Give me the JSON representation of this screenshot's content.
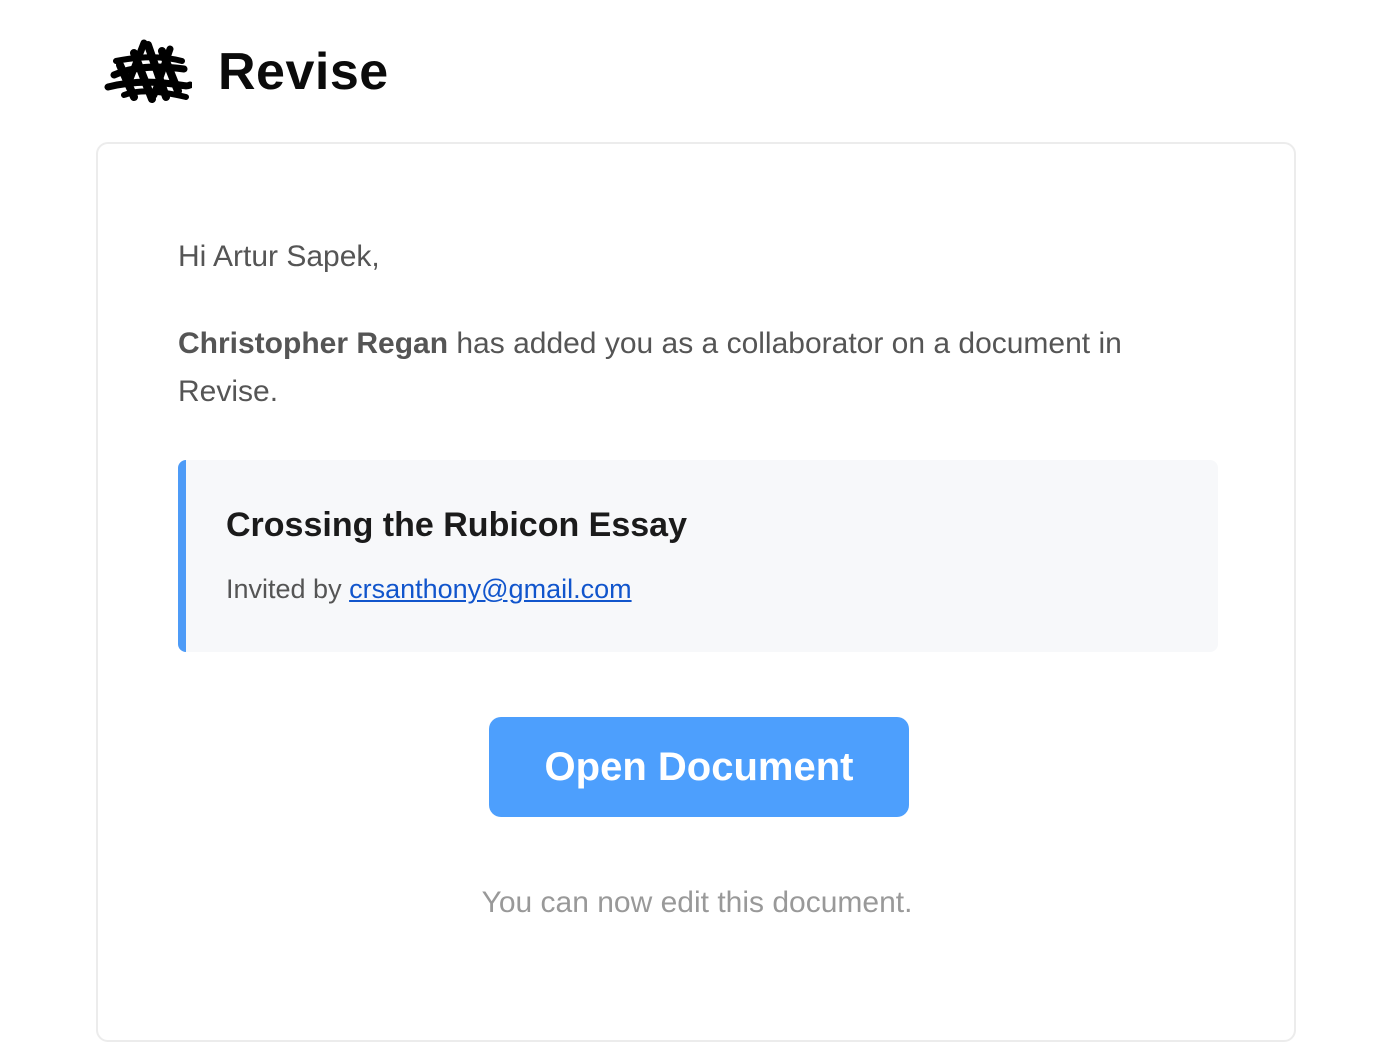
{
  "header": {
    "logo_icon": "scribble-logo-icon",
    "brand": "Revise"
  },
  "email": {
    "greeting": "Hi Artur Sapek,",
    "inviter_name": "Christopher Regan",
    "intro_text": " has added you as a collaborator on a document in Revise.",
    "document": {
      "title": "Crossing the Rubicon Essay",
      "invited_by_label": "Invited by ",
      "invited_by_email": "crsanthony@gmail.com"
    },
    "cta_label": "Open Document",
    "footer_note": "You can now edit this document."
  },
  "colors": {
    "accent": "#4d9ffd",
    "accent_border": "#4d9bf7",
    "link": "#1155cc",
    "text": "#555555",
    "muted": "#999999"
  }
}
